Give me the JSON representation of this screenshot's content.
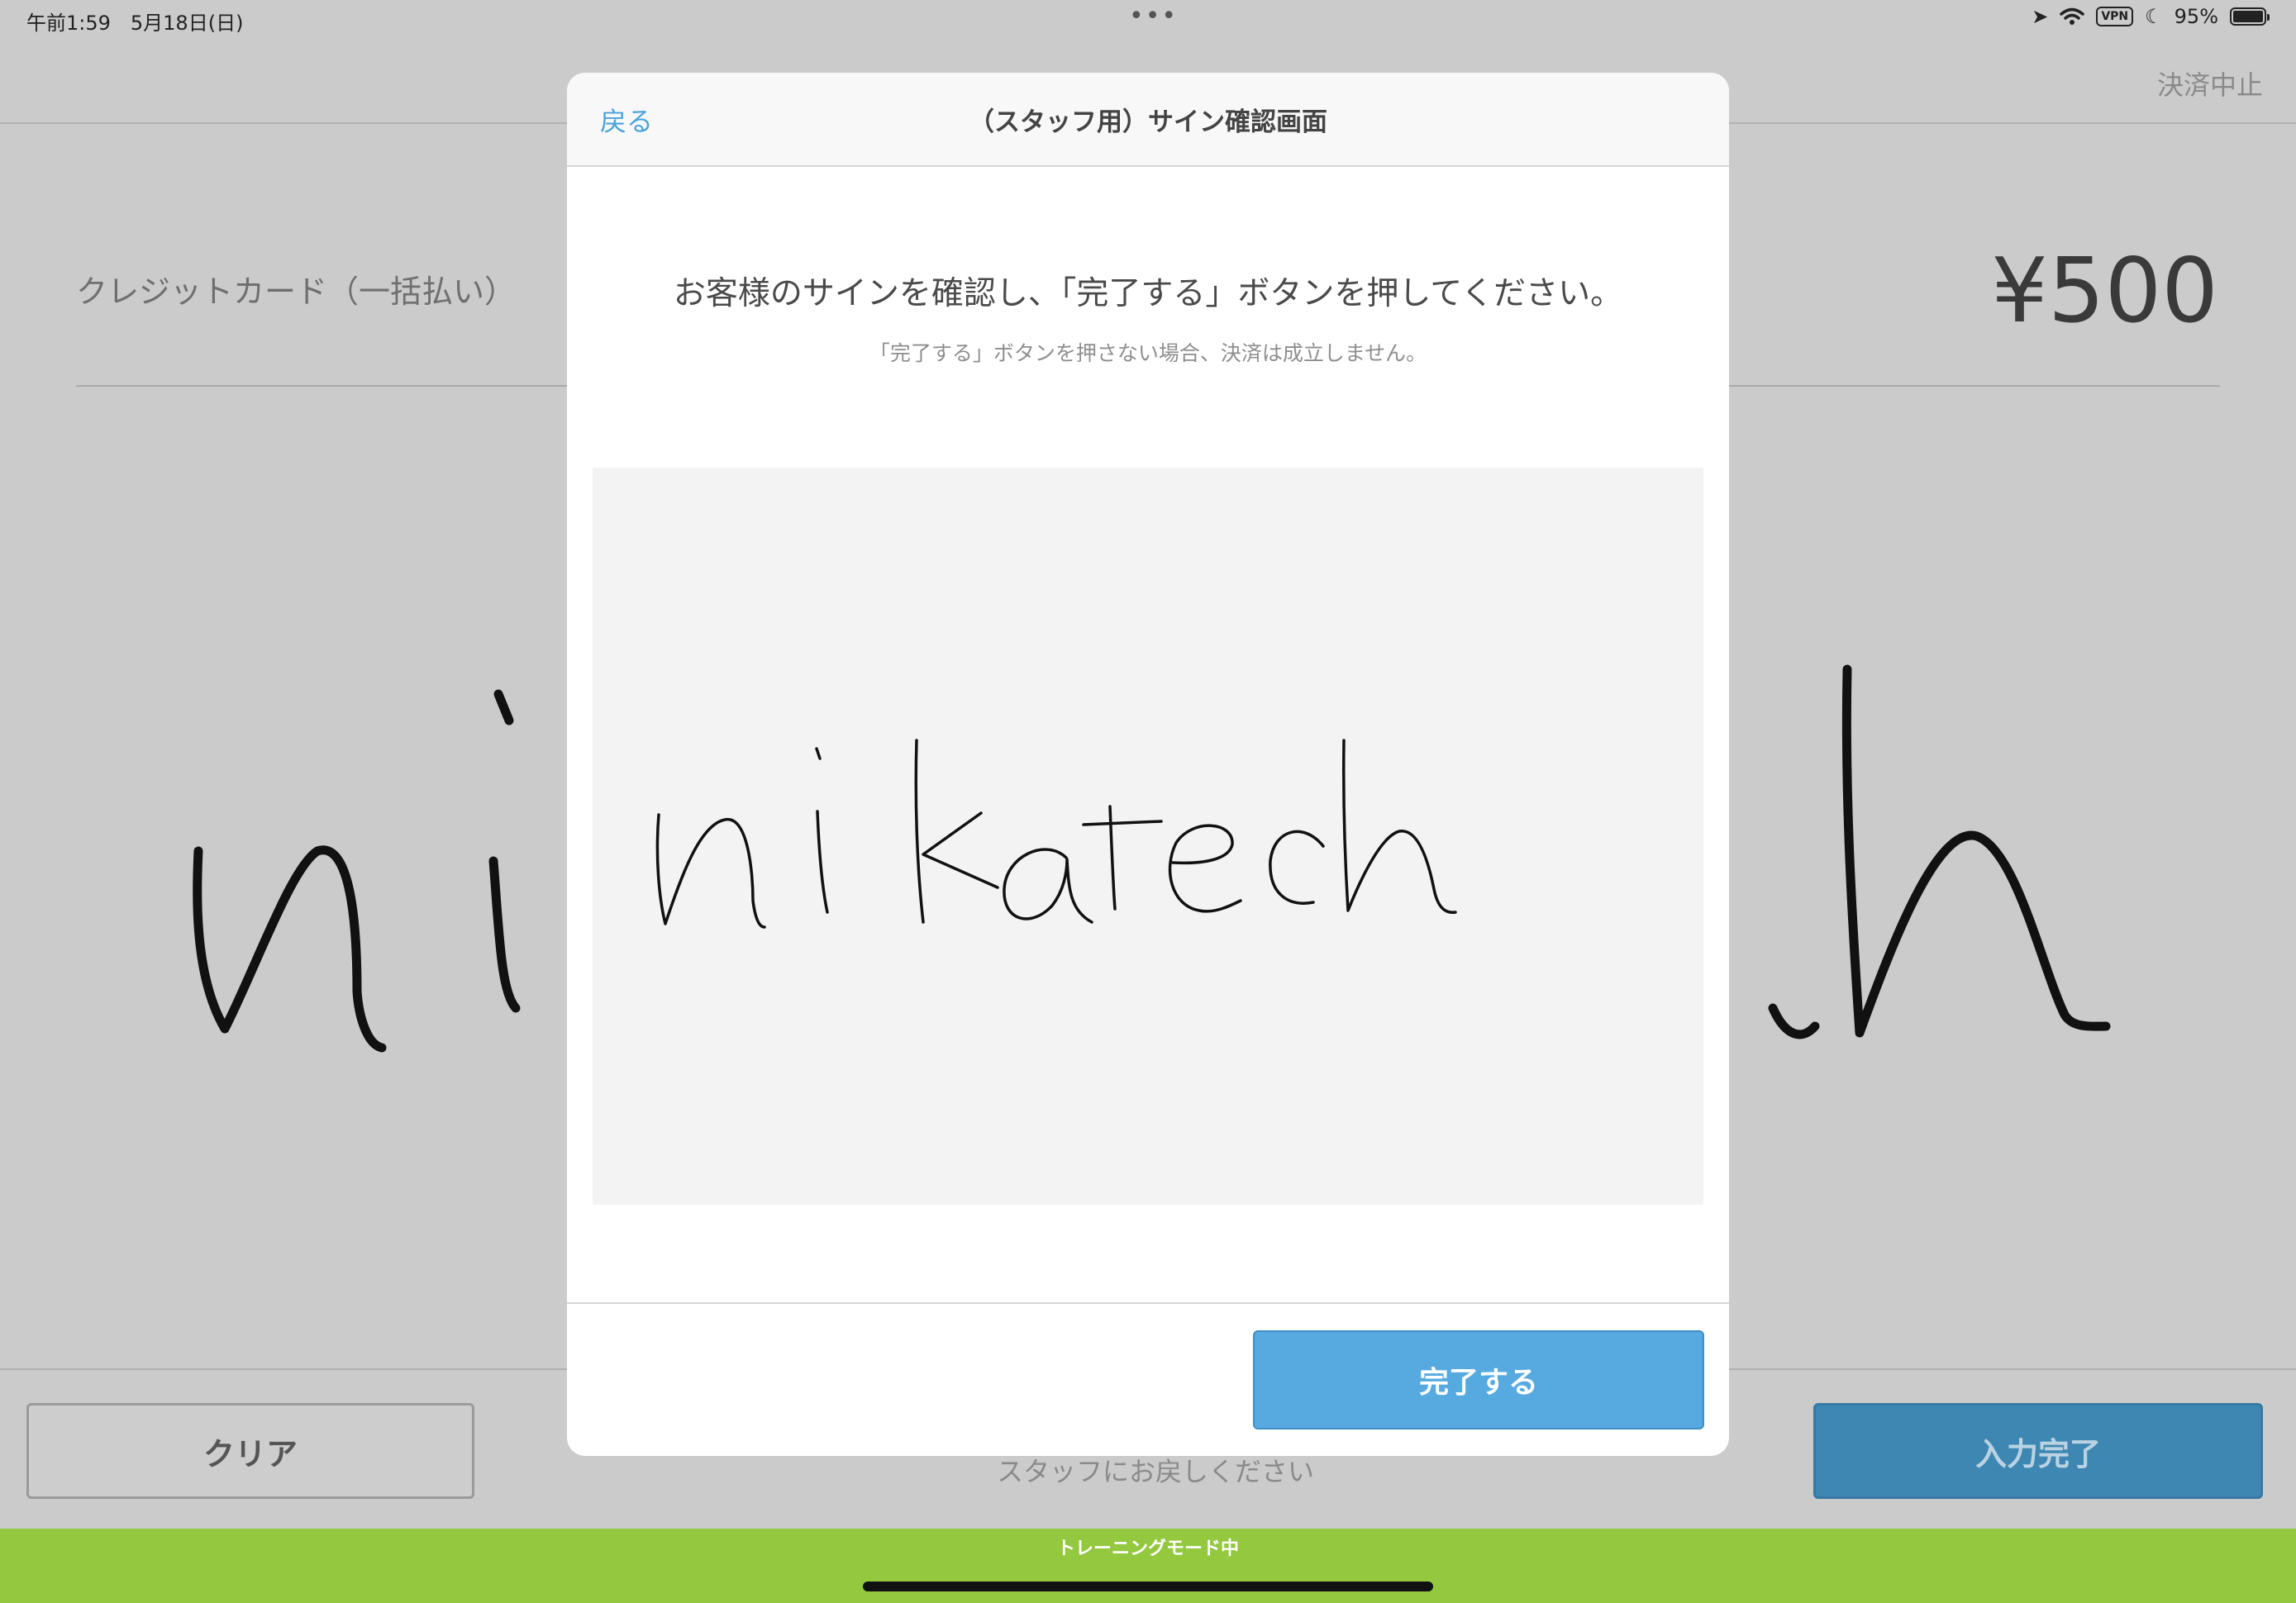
{
  "status_bar": {
    "time": "午前1:59　5月18日(日)",
    "more": "•••",
    "vpn": "VPN",
    "battery": "95%"
  },
  "background": {
    "cancel_payment": "決済中止",
    "payment_method": "クレジットカード（一括払い）",
    "amount": "¥500",
    "clear_button": "クリア",
    "return_hint": "スタッフにお戻しください",
    "input_done_button": "入力完了",
    "training_mode": "トレーニングモード中"
  },
  "modal": {
    "back": "戻る",
    "title": "（スタッフ用）サイン確認画面",
    "instruction": "お客様のサインを確認し、「完了する」ボタンを押してください。",
    "sub_instruction": "「完了する」ボタンを押さない場合、決済は成立しません。",
    "complete_button": "完了する"
  },
  "colors": {
    "accent": "#56aae0",
    "training_bar": "#93c83f",
    "signature_bg": "#f3f3f3"
  }
}
